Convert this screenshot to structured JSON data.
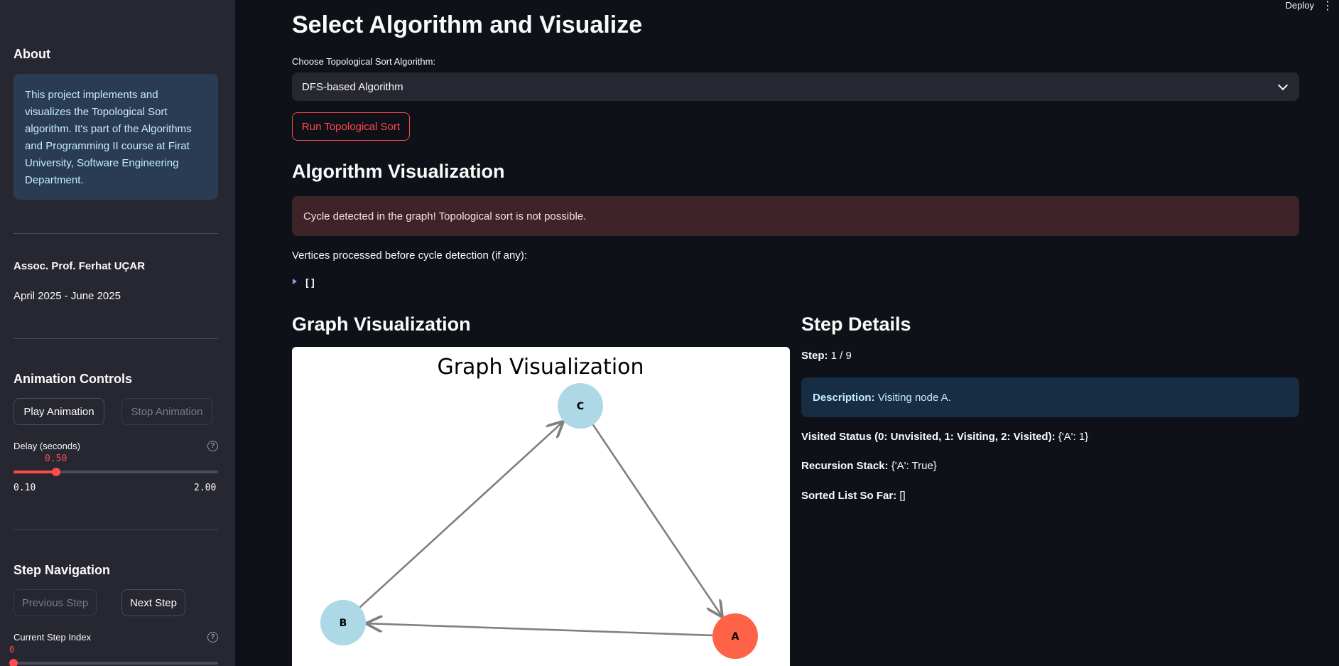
{
  "sidebar": {
    "about_title": "About",
    "about_text": "This project implements and visualizes the Topological Sort algorithm. It's part of the Algorithms and Programming II course at Firat University, Software Engineering Department.",
    "author": "Assoc. Prof. Ferhat UÇAR",
    "dates": "April 2025 - June 2025",
    "animation_title": "Animation Controls",
    "play_label": "Play Animation",
    "stop_label": "Stop Animation",
    "delay_label": "Delay (seconds)",
    "delay_value": "0.50",
    "delay_min": "0.10",
    "delay_max": "2.00",
    "delay_fraction": 0.21,
    "step_nav_title": "Step Navigation",
    "prev_label": "Previous Step",
    "next_label": "Next Step",
    "step_index_label": "Current Step Index",
    "step_index_value": "0",
    "help_glyph": "?"
  },
  "header": {
    "deploy_label": "Deploy",
    "menu_glyph": "⋮"
  },
  "main": {
    "title": "Select Algorithm and Visualize",
    "select_label": "Choose Topological Sort Algorithm:",
    "select_value": "DFS-based Algorithm",
    "run_label": "Run Topological Sort",
    "viz_title": "Algorithm Visualization",
    "error_text": "Cycle detected in the graph! Topological sort is not possible.",
    "processed_label": "Vertices processed before cycle detection (if any):",
    "processed_value": "[]",
    "graph_title": "Graph Visualization",
    "details_title": "Step Details"
  },
  "graph": {
    "title": "Graph Visualization",
    "nodes": [
      {
        "id": "C",
        "color": "#add8e6"
      },
      {
        "id": "B",
        "color": "#add8e6"
      },
      {
        "id": "A",
        "color": "#ff6347"
      }
    ],
    "edges": [
      [
        "B",
        "C"
      ],
      [
        "C",
        "A"
      ],
      [
        "A",
        "B"
      ]
    ]
  },
  "details": {
    "step_label": "Step:",
    "step_value": "1 / 9",
    "desc_label": "Description:",
    "desc_value": "Visiting node A.",
    "visited_label": "Visited Status (0: Unvisited, 1: Visiting, 2: Visited):",
    "visited_value": "{'A': 1}",
    "stack_label": "Recursion Stack:",
    "stack_value": "{'A': True}",
    "sorted_label": "Sorted List So Far:",
    "sorted_value": "[]"
  },
  "colors": {
    "accent": "#ff4b4b",
    "error_bg": "#3e2428",
    "info_bg": "#172d43"
  }
}
